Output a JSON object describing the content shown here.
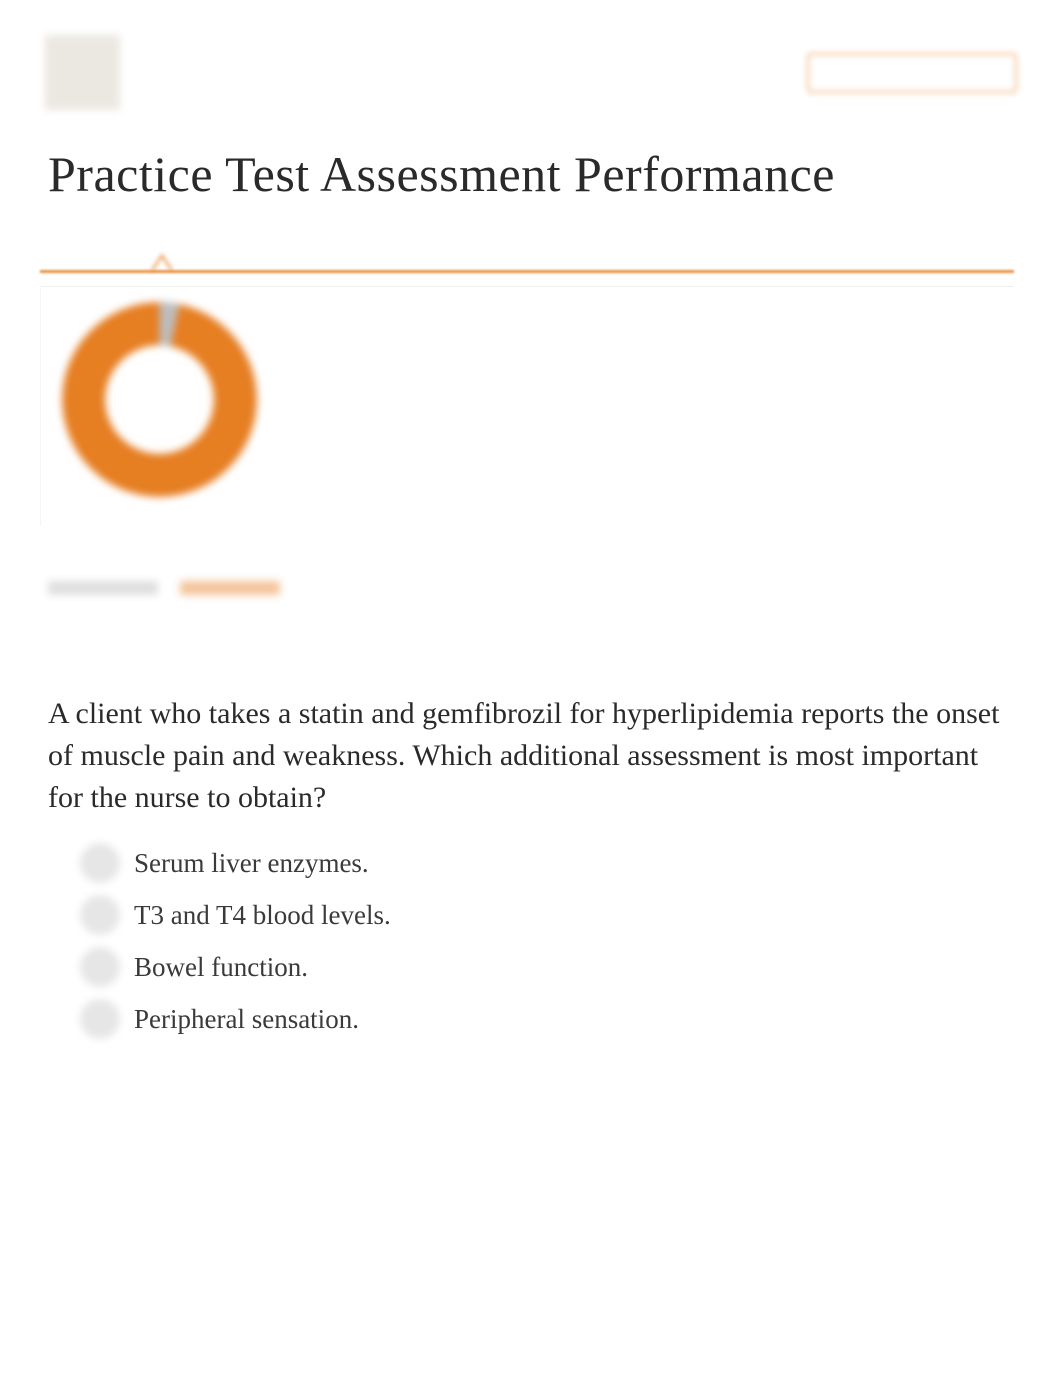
{
  "header": {
    "button_label": ""
  },
  "page": {
    "title": "Practice Test Assessment Performance"
  },
  "chart_data": {
    "type": "pie",
    "title": "",
    "slider_position_pct": 11,
    "donut": {
      "primary_pct": 96,
      "secondary_pct": 4,
      "primary_color": "#e67e22",
      "secondary_color": "#bdbdbd"
    }
  },
  "tabs": {
    "items": [
      {
        "label": "",
        "active": false,
        "width": 110
      },
      {
        "label": "",
        "active": true,
        "width": 100
      }
    ]
  },
  "question": {
    "text": "A client who takes a statin and gemfibrozil for hyperlipidemia reports the onset of muscle pain and weakness. Which additional assessment is most  important for the nurse to obtain?",
    "answers": [
      {
        "label": "Serum liver enzymes."
      },
      {
        "label": "T3 and T4 blood levels."
      },
      {
        "label": "Bowel function."
      },
      {
        "label": "Peripheral sensation."
      }
    ]
  }
}
